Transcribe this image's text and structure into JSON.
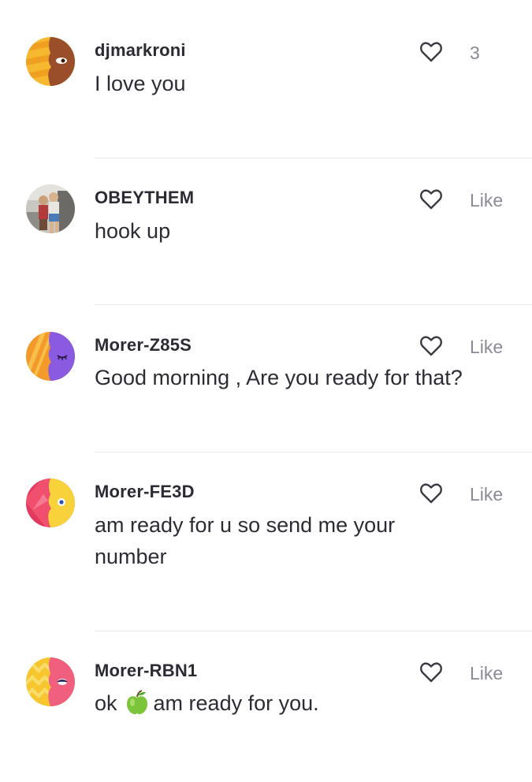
{
  "comments": [
    {
      "username": "djmarkroni",
      "text": "I love you",
      "like_label": "3",
      "avatar": "yellow-brown-face-avatar"
    },
    {
      "username": "OBEYTHEM",
      "text": "hook up",
      "like_label": "Like",
      "avatar": "photo-avatar"
    },
    {
      "username": "Morer-Z85S",
      "text": "Good morning , Are you ready for that?",
      "like_label": "Like",
      "avatar": "orange-purple-face-avatar"
    },
    {
      "username": "Morer-FE3D",
      "text": "am ready for u  so send me your number",
      "like_label": "Like",
      "avatar": "pink-yellow-face-avatar"
    },
    {
      "username": "Morer-RBN1",
      "text_before": "ok",
      "text_after": "am ready for you.",
      "like_label": "Like",
      "avatar": "yellow-pink-face-avatar",
      "inline_icon": "green-apple-icon"
    }
  ],
  "colors": {
    "username": "#2b2b33",
    "text": "#2c2c34",
    "like_label": "#8a8a95",
    "divider": "#e8e8ec",
    "heart_stroke": "#3a3a42"
  }
}
